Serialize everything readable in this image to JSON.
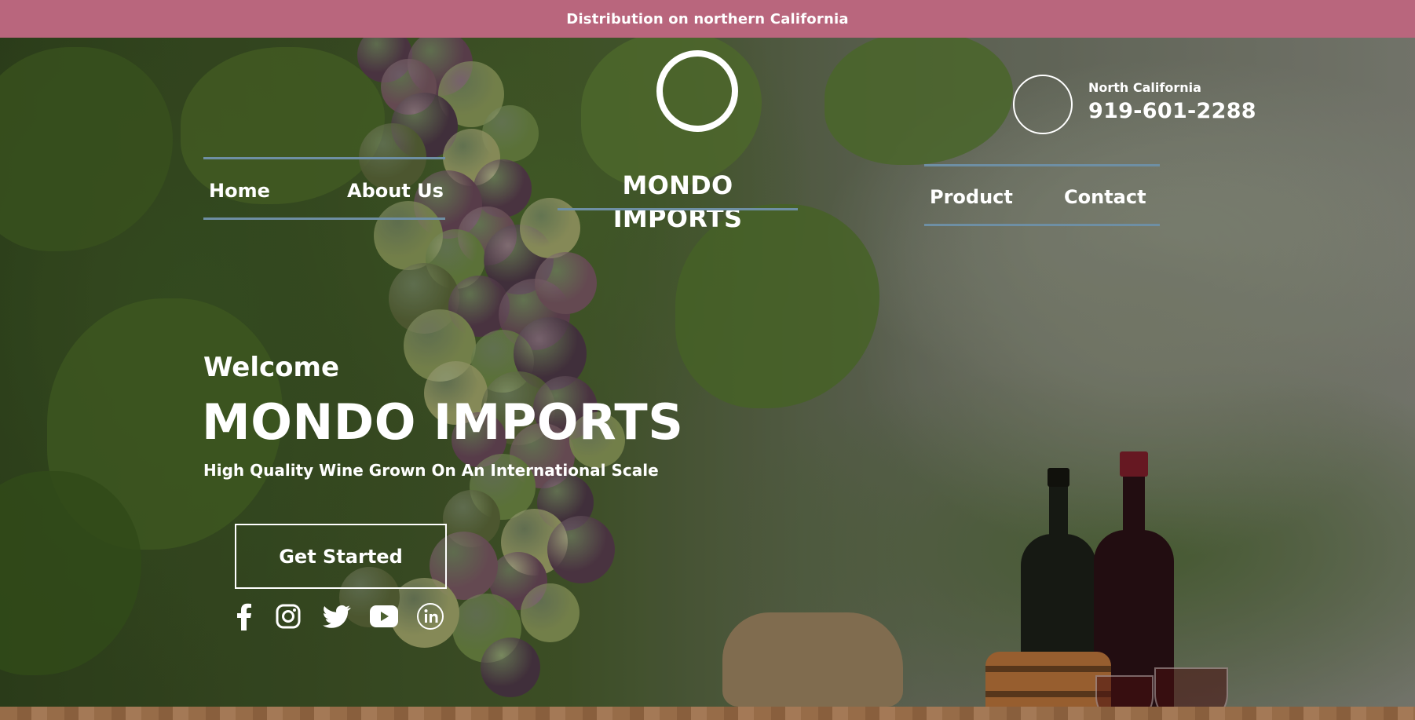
{
  "banner": {
    "text": "Distribution on northern California"
  },
  "header": {
    "brand": "MONDO IMPORTS",
    "nav_left": [
      {
        "label": "Home"
      },
      {
        "label": "About Us"
      }
    ],
    "nav_right": [
      {
        "label": "Product"
      },
      {
        "label": "Contact"
      }
    ],
    "contact": {
      "region": "North California",
      "phone": "919-601-2288"
    }
  },
  "hero": {
    "welcome": "Welcome",
    "title": "MONDO IMPORTS",
    "subtitle": "High Quality Wine Grown On An International Scale",
    "cta_label": "Get Started"
  },
  "social": [
    "facebook-icon",
    "instagram-icon",
    "twitter-icon",
    "youtube-icon",
    "linkedin-icon"
  ],
  "colors": {
    "banner": "#b9667d",
    "nav_line": "#6e8fa4",
    "text": "#ffffff"
  }
}
